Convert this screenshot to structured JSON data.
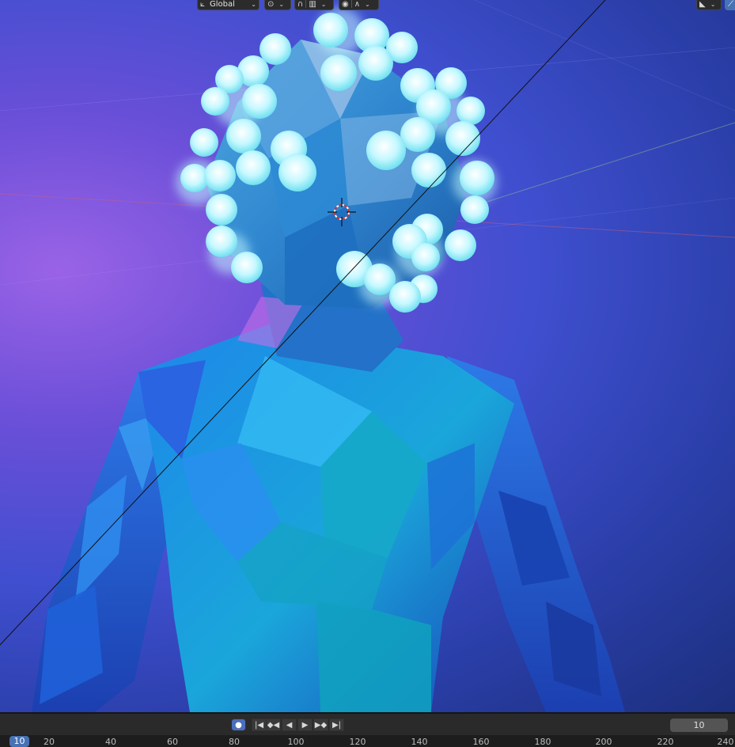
{
  "header": {
    "transform_orientation": "Global",
    "transform_icon": "transform-orientation-icon",
    "pivot_icon": "pivot-point-icon",
    "snap_icon": "snap-magnet-icon",
    "snap_target_icon": "snap-target-icon",
    "proportional_icon": "proportional-editing-icon",
    "falloff_icon": "falloff-curve-icon",
    "gizmo_icon": "gizmo-toggle-icon"
  },
  "timeline": {
    "current_frame": "10",
    "ruler_labels": [
      "10",
      "20",
      "40",
      "60",
      "80",
      "100",
      "120",
      "140",
      "160",
      "180",
      "200",
      "220",
      "240"
    ],
    "buttons": {
      "record": "●",
      "jump_start": "|◀",
      "prev_keyframe": "◆◀",
      "play_reverse": "◀",
      "play": "▶",
      "next_keyframe": "▶◆",
      "jump_end": "▶|"
    }
  },
  "colors": {
    "background_purple": "#9a63e6",
    "background_blue": "#1c2f7d",
    "character_cyan": "#19b8e8",
    "glow_bubble": "#d8fbff",
    "accent": "#4772b3"
  }
}
